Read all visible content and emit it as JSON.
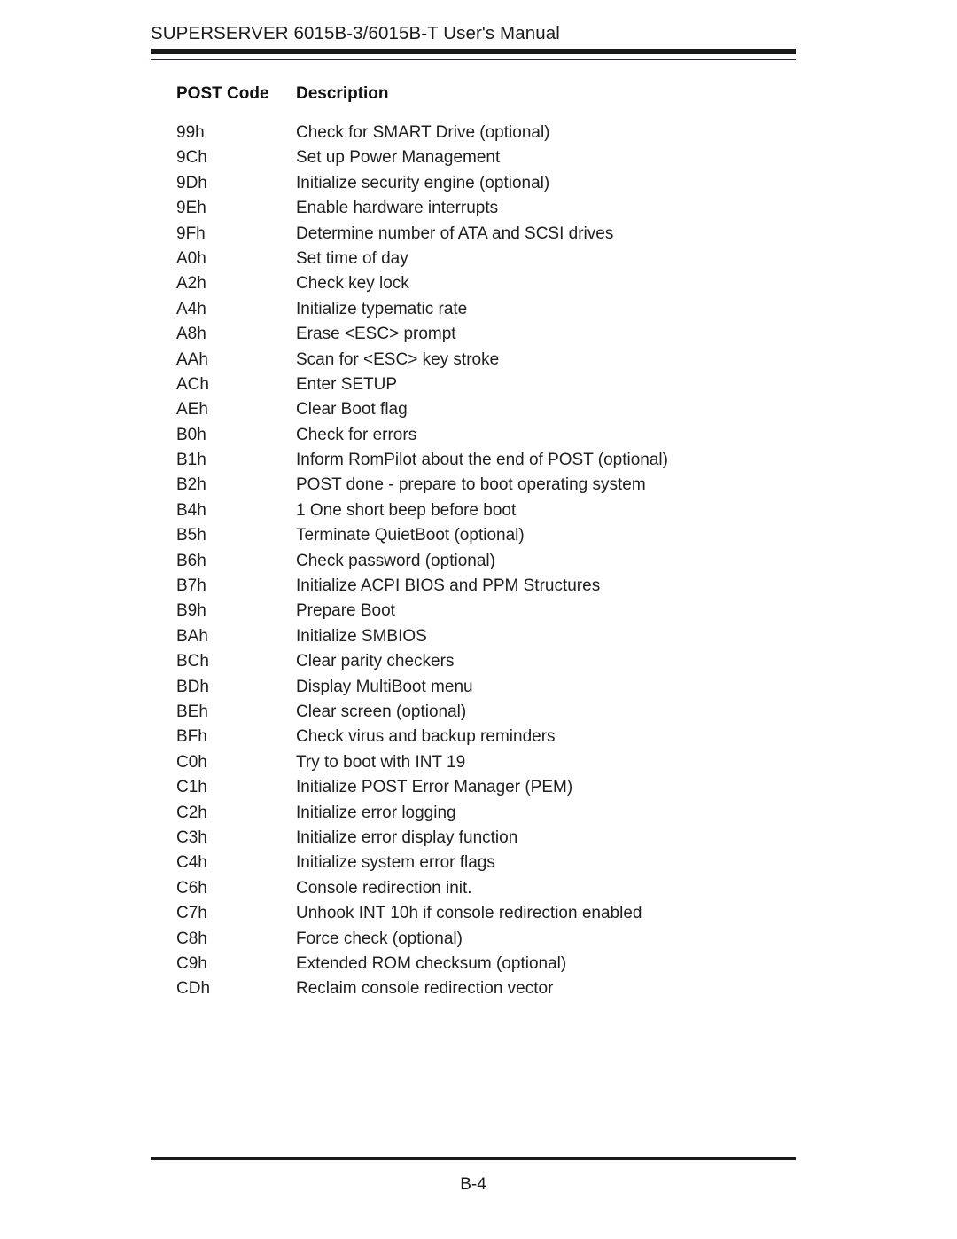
{
  "header": {
    "title_prefix": "S",
    "title_full": "SUPERSERVER 6015B-3/6015B-T User's Manual",
    "title_brand": "SUPERSERVER",
    "title_rest": " 6015B-3/6015B-T User's Manual"
  },
  "table": {
    "columns": {
      "code": "POST Code",
      "description": "Description"
    },
    "rows": [
      {
        "code": "99h",
        "description": "Check for SMART Drive (optional)"
      },
      {
        "code": "9Ch",
        "description": "Set up Power Management"
      },
      {
        "code": "9Dh",
        "description": "Initialize security engine (optional)"
      },
      {
        "code": "9Eh",
        "description": "Enable hardware interrupts"
      },
      {
        "code": "9Fh",
        "description": "Determine number of ATA and SCSI drives"
      },
      {
        "code": "A0h",
        "description": "Set time of day"
      },
      {
        "code": "A2h",
        "description": "Check key lock"
      },
      {
        "code": "A4h",
        "description": "Initialize typematic rate"
      },
      {
        "code": "A8h",
        "description": "Erase <ESC> prompt"
      },
      {
        "code": "AAh",
        "description": "Scan for <ESC> key stroke"
      },
      {
        "code": "ACh",
        "description": "Enter SETUP"
      },
      {
        "code": "AEh",
        "description": "Clear Boot flag"
      },
      {
        "code": "B0h",
        "description": "Check for errors"
      },
      {
        "code": "B1h",
        "description": "Inform RomPilot about the end of POST (optional)"
      },
      {
        "code": "B2h",
        "description": "POST done - prepare to boot operating system"
      },
      {
        "code": "B4h",
        "description": "1 One short beep before boot"
      },
      {
        "code": "B5h",
        "description": "Terminate QuietBoot (optional)"
      },
      {
        "code": "B6h",
        "description": "Check password (optional)"
      },
      {
        "code": "B7h",
        "description": "Initialize ACPI BIOS and PPM Structures"
      },
      {
        "code": "B9h",
        "description": "Prepare Boot"
      },
      {
        "code": "BAh",
        "description": "Initialize SMBIOS"
      },
      {
        "code": "BCh",
        "description": "Clear parity checkers"
      },
      {
        "code": "BDh",
        "description": "Display MultiBoot menu"
      },
      {
        "code": "BEh",
        "description": "Clear screen (optional)"
      },
      {
        "code": "BFh",
        "description": "Check virus and backup reminders"
      },
      {
        "code": "C0h",
        "description": "Try to boot with INT 19"
      },
      {
        "code": "C1h",
        "description": "Initialize POST Error Manager (PEM)"
      },
      {
        "code": "C2h",
        "description": "Initialize error logging"
      },
      {
        "code": "C3h",
        "description": "Initialize error display function"
      },
      {
        "code": "C4h",
        "description": "Initialize system error flags"
      },
      {
        "code": "C6h",
        "description": "Console redirection init."
      },
      {
        "code": "C7h",
        "description": "Unhook INT 10h if console redirection enabled"
      },
      {
        "code": "C8h",
        "description": "Force check (optional)"
      },
      {
        "code": "C9h",
        "description": "Extended ROM checksum (optional)"
      },
      {
        "code": "CDh",
        "description": "Reclaim console redirection vector"
      }
    ]
  },
  "footer": {
    "page_number": "B-4"
  }
}
